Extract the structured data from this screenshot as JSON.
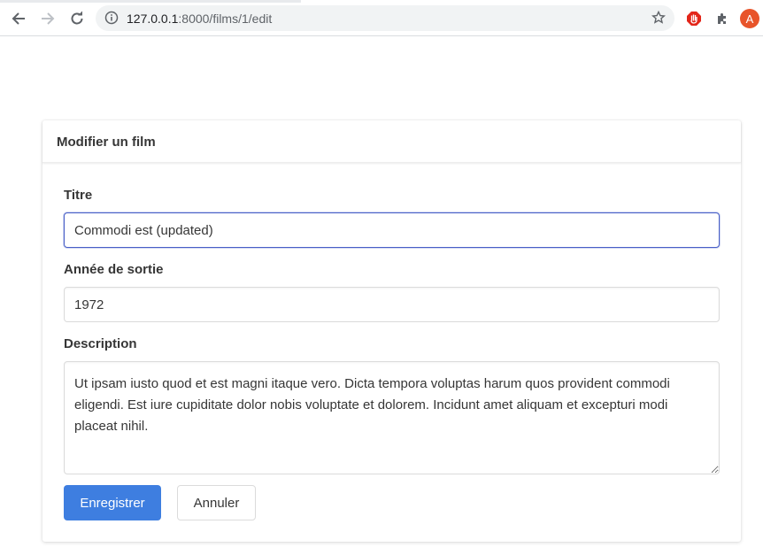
{
  "browser": {
    "url_host": "127.0.0.1",
    "url_rest": ":8000/films/1/edit",
    "profile_initial": "A"
  },
  "card": {
    "title": "Modifier un film"
  },
  "form": {
    "title_label": "Titre",
    "title_value": "Commodi est (updated)",
    "year_label": "Année de sortie",
    "year_value": "1972",
    "description_label": "Description",
    "description_value": "Ut ipsam iusto quod et est magni itaque vero. Dicta tempora voluptas harum quos provident commodi eligendi. Est iure cupiditate dolor nobis voluptate et dolorem. Incidunt amet aliquam et excepturi modi placeat nihil."
  },
  "actions": {
    "save_label": "Enregistrer",
    "cancel_label": "Annuler"
  },
  "colors": {
    "primary": "#3e7ee0",
    "focus": "#485fc7",
    "avatar": "#e8542a"
  }
}
